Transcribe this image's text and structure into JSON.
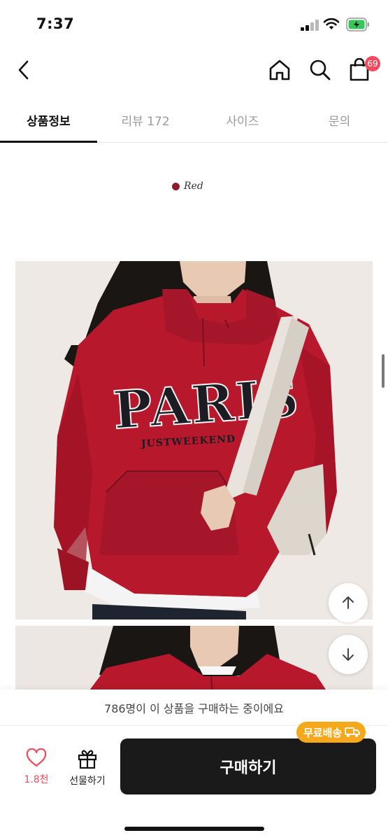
{
  "status_bar": {
    "time": "7:37"
  },
  "header": {
    "back_icon": "chevron-left-icon",
    "home_icon": "home-icon",
    "search_icon": "search-icon",
    "cart_icon": "shopping-bag-icon",
    "cart_badge": "69"
  },
  "tabs": [
    {
      "label": "상품정보",
      "active": true
    },
    {
      "label": "리뷰 172",
      "active": false
    },
    {
      "label": "사이즈",
      "active": false
    },
    {
      "label": "문의",
      "active": false
    }
  ],
  "product": {
    "color_label": "Red",
    "color_swatch": "#8e1b2c",
    "print_main": "PARIS",
    "print_sub": "JUSTWEEKEND"
  },
  "float_buttons": {
    "up_icon": "arrow-up-icon",
    "down_icon": "arrow-down-icon"
  },
  "bottom_bar": {
    "buying_note": "786명이 이 상품을 구매하는 중이에요",
    "like_count": "1.8천",
    "gift_label": "선물하기",
    "buy_label": "구매하기",
    "free_shipping_badge": "무료배송"
  },
  "colors": {
    "accent_pink": "#f04b5e",
    "badge_orange": "#f6a81c",
    "buy_button": "#1a1a1a"
  }
}
